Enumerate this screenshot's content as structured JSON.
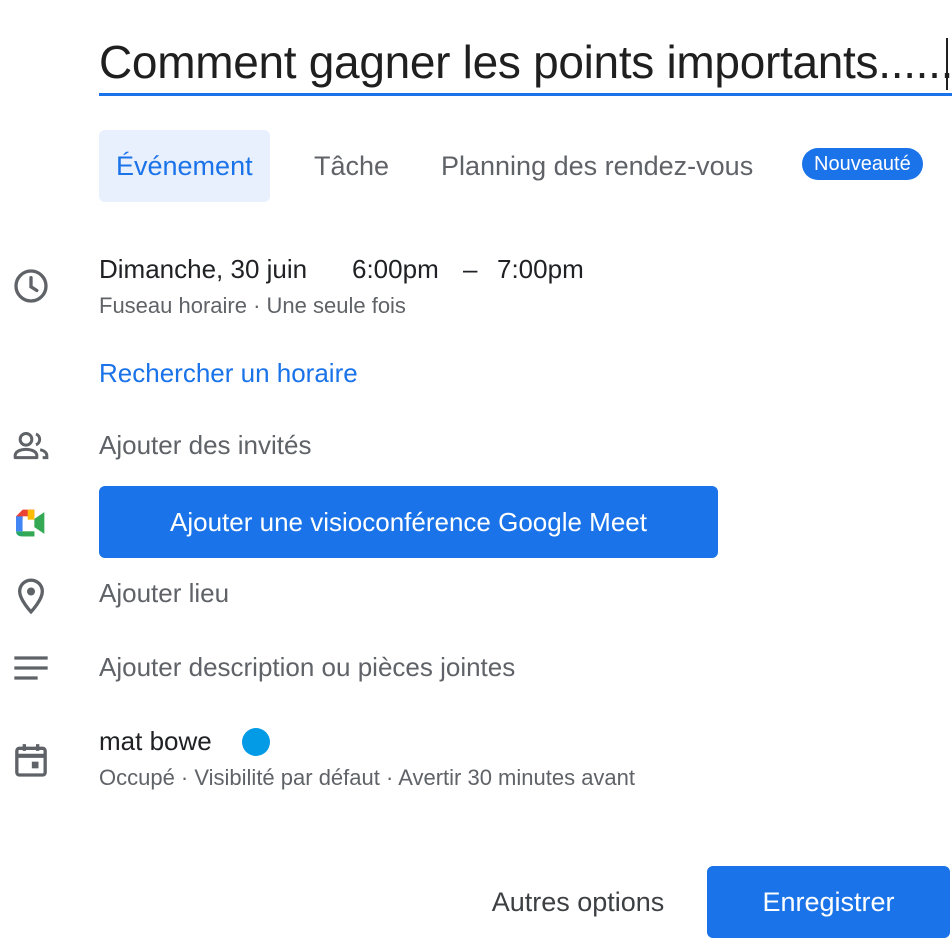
{
  "title": {
    "value": "Comment gagner les points importants......"
  },
  "tabs": [
    {
      "label": "Événement",
      "active": true
    },
    {
      "label": "Tâche",
      "active": false
    },
    {
      "label": "Planning des rendez-vous",
      "active": false
    }
  ],
  "badge": "Nouveauté",
  "datetime": {
    "date": "Dimanche, 30 juin",
    "start": "6:00pm",
    "separator": "–",
    "end": "7:00pm",
    "sub": "Fuseau horaire · Une seule fois"
  },
  "find_time_link": "Rechercher un horaire",
  "guests_placeholder": "Ajouter des invités",
  "meet_button": "Ajouter une visioconférence Google Meet",
  "location_placeholder": "Ajouter lieu",
  "description_placeholder": "Ajouter description ou pièces jointes",
  "calendar": {
    "name": "mat bowe",
    "color": "#039be5",
    "sub": "Occupé · Visibilité par défaut · Avertir 30 minutes avant"
  },
  "footer": {
    "more_options": "Autres options",
    "save": "Enregistrer"
  },
  "colors": {
    "accent": "#1a73e8",
    "calendar_dot": "#039be5"
  },
  "icons": [
    "clock-icon",
    "people-icon",
    "google-meet-icon",
    "location-pin-icon",
    "description-icon",
    "calendar-icon"
  ]
}
